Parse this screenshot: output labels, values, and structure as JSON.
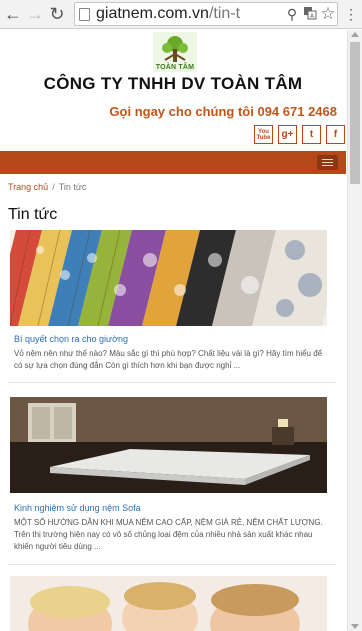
{
  "browser": {
    "url_domain": "giatnem.com.vn",
    "url_path": "/tin-t"
  },
  "header": {
    "logo_text": "TOÀN TÂM",
    "company_name": "CÔNG TY TNHH DV TOÀN TÂM",
    "call_us": "Gọi ngay cho chúng tôi 094 671 2468",
    "social": [
      "You Tube",
      "g+",
      "t",
      "f"
    ]
  },
  "breadcrumb": {
    "home": "Trang chủ",
    "separator": "/",
    "current": "Tin tức"
  },
  "section_title": "Tin tức",
  "articles": [
    {
      "title": "Bí quyết chọn ra cho giường",
      "excerpt": "Vỏ nệm nên như thế nào? Màu sắc gì thì phù hợp? Chất liệu vải là gì? Hãy tìm hiểu để có sự lựa chọn đúng đắn Còn gì thích hơn khi bạn được nghỉ ..."
    },
    {
      "title": "Kinh nghiệm sử dụng nệm Sofa",
      "excerpt": "MỘT SỐ HƯỚNG DẪN KHI MUA NỆM CAO CẤP, NỆM GIÁ RẺ, NỆM CHẤT LƯỢNG.   Trên thị trường hiện nay có vô số chủng loại đệm của nhiều nhà sản xuất khác nhau khiến người tiêu dùng ..."
    }
  ],
  "colors": {
    "brand": "#b5491a",
    "link": "#2a6fb4",
    "call": "#c0561b"
  }
}
